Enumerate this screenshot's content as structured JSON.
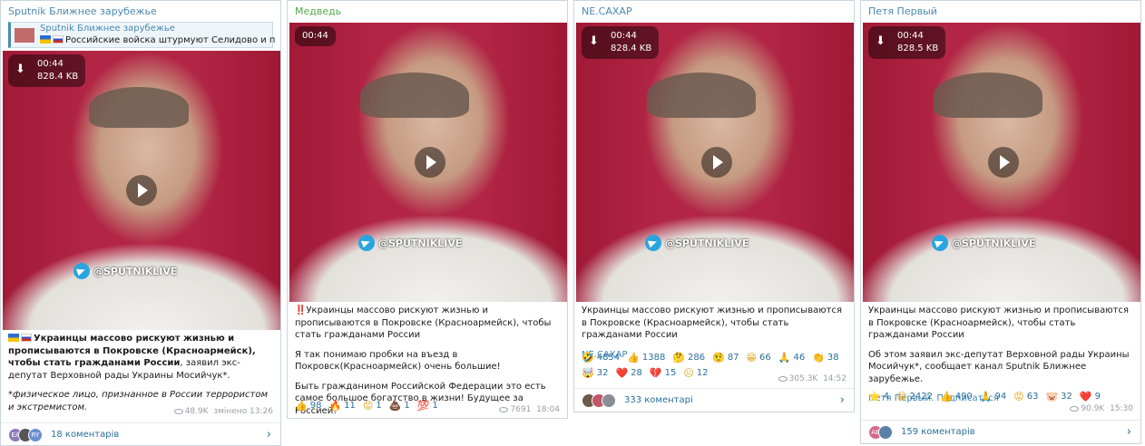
{
  "posts": [
    {
      "channel": "Sputnik Ближнее зарубежье",
      "reply": {
        "title": "Sputnik Ближнее зарубежье",
        "snippet": "Российские войска штурмуют Селидово и п..."
      },
      "video": {
        "duration": "00:44",
        "size": "828.4 KB",
        "watermark": "@SPUTNIKLIVE"
      },
      "text": {
        "lead": "Украинцы массово рискуют жизнью и прописываются в Покровске (Красноармейск), чтобы стать гражданами России",
        "rest": ", заявил экс-депутат Верховной рады Украины Мосийчук*.",
        "note": "*физическое лицо, признанное в России террористом и экстремистом."
      },
      "views": "48.9K",
      "time": "змінено 13:26",
      "comments": "18 коментарів",
      "avatars": [
        "EA",
        "",
        "RY"
      ]
    },
    {
      "channel": "Медведь",
      "video": {
        "duration": "00:44",
        "watermark": "@SPUTNIKLIVE"
      },
      "paragraphs": [
        "Украинцы массово рискуют жизнью и прописываются в Покровске (Красноармейск), чтобы стать гражданами России",
        "Я так понимаю пробки на въезд в Покровск(Красноармейск) очень большие!",
        "Быть гражданином Российской Федерации это есть самое большое богатство в жизни! Будущее за Россией!"
      ],
      "bang": "‼️",
      "reactions": [
        {
          "emoji": "👍",
          "count": "98"
        },
        {
          "emoji": "🔥",
          "count": "11"
        },
        {
          "emoji": "😡",
          "count": "1"
        },
        {
          "emoji": "💩",
          "count": "1"
        },
        {
          "emoji": "💯",
          "count": "1"
        }
      ],
      "views": "7691",
      "time": "18:04"
    },
    {
      "channel": "NE.CAXAP",
      "video": {
        "duration": "00:44",
        "size": "828.4 KB",
        "watermark": "@SPUTNIKLIVE"
      },
      "paragraphs": [
        "Украинцы массово рискуют жизнью и прописываются в Покровске (Красноармейск), чтобы стать гражданами России"
      ],
      "signature": "NE.CAXAP",
      "reactions": [
        {
          "emoji": "🤣",
          "count": "4854"
        },
        {
          "emoji": "👍",
          "count": "1388"
        },
        {
          "emoji": "🤔",
          "count": "286"
        },
        {
          "emoji": "🤨",
          "count": "87"
        },
        {
          "emoji": "😁",
          "count": "66"
        },
        {
          "emoji": "🙏",
          "count": "46"
        },
        {
          "emoji": "👏",
          "count": "38"
        },
        {
          "emoji": "🤯",
          "count": "32"
        },
        {
          "emoji": "❤️",
          "count": "28"
        },
        {
          "emoji": "💔",
          "count": "15"
        },
        {
          "emoji": "😐",
          "count": "12"
        }
      ],
      "views": "305.3K",
      "time": "14:52",
      "comments": "333 коментарі"
    },
    {
      "channel": "Петя Первый",
      "video": {
        "duration": "00:44",
        "size": "828.5 KB",
        "watermark": "@SPUTNIKLIVE"
      },
      "paragraphs": [
        "Украинцы массово рискуют жизнью и прописываются в Покровске (Красноармейск), чтобы стать гражданами России",
        "Об этом заявил экс-депутат Верховной рады Украины Мосийчук*, сообщает канал Sputnik Ближнее зарубежье."
      ],
      "signature": "Петя Первый. Подписаться",
      "reactions": [
        {
          "emoji": "⭐",
          "count": "4"
        },
        {
          "emoji": "😁",
          "count": "2422"
        },
        {
          "emoji": "👍",
          "count": "490"
        },
        {
          "emoji": "🙏",
          "count": "94"
        },
        {
          "emoji": "😡",
          "count": "63"
        },
        {
          "emoji": "🐷",
          "count": "32"
        },
        {
          "emoji": "❤️",
          "count": "9"
        }
      ],
      "views": "90.9K",
      "time": "15:30",
      "comments": "159 коментарів",
      "avatars": [
        "AB",
        ""
      ]
    }
  ],
  "colors": {
    "accent": "#2b6e9b",
    "title": "#4a8ab0",
    "border": "#c9d6df"
  }
}
